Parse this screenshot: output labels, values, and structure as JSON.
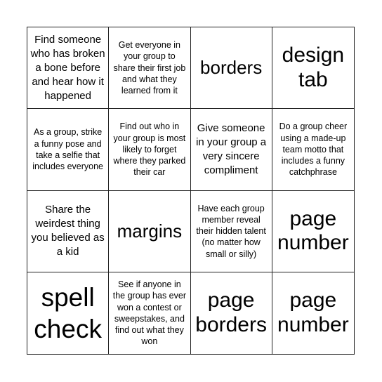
{
  "board": {
    "cells": [
      {
        "text": "Find someone who has broken a bone before and hear how it happened",
        "size": "medium"
      },
      {
        "text": "Get everyone in your group to share their first job and what they learned from it",
        "size": "small"
      },
      {
        "text": "borders",
        "size": "large"
      },
      {
        "text": "design tab",
        "size": "xlarge"
      },
      {
        "text": "As a group, strike a funny pose and take a selfie that includes everyone",
        "size": "small"
      },
      {
        "text": "Find out who in your group is most likely to forget where they parked their car",
        "size": "small"
      },
      {
        "text": "Give someone in your group a very sincere compliment",
        "size": "medium"
      },
      {
        "text": "Do a group cheer using a made-up team motto that includes a funny catchphrase",
        "size": "small"
      },
      {
        "text": "Share the weirdest thing you believed as a kid",
        "size": "medium"
      },
      {
        "text": "margins",
        "size": "large"
      },
      {
        "text": "Have each group member reveal their hidden talent (no matter how small or silly)",
        "size": "small"
      },
      {
        "text": "page number",
        "size": "xlarge"
      },
      {
        "text": "spell check",
        "size": "xxlarge"
      },
      {
        "text": "See if anyone in the group has ever won a contest or sweepstakes, and find out what they won",
        "size": "small"
      },
      {
        "text": "page borders",
        "size": "xlarge"
      },
      {
        "text": "page number",
        "size": "xlarge"
      }
    ]
  }
}
